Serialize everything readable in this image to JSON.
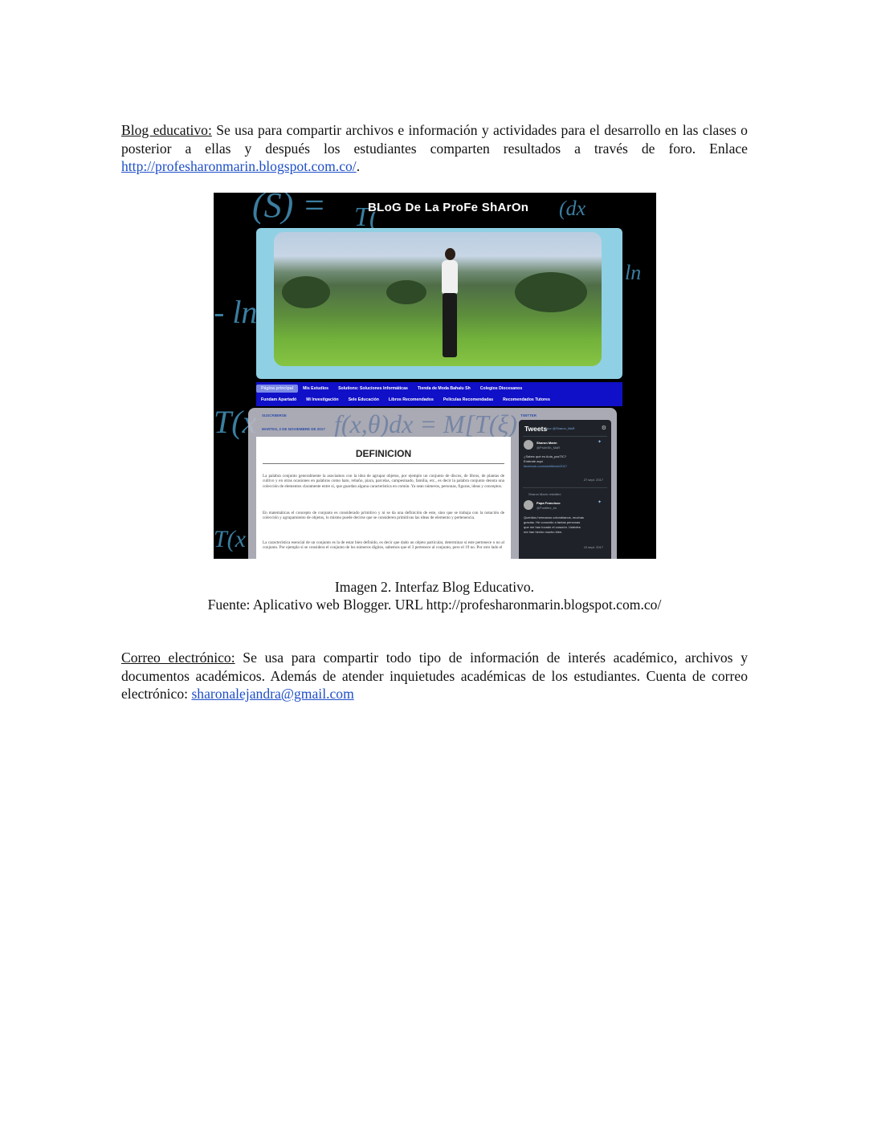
{
  "section1": {
    "lead": "Blog educativo:",
    "body": " Se usa para compartir archivos e información y actividades para el desarrollo en las clases o posterior a ellas y después los estudiantes comparten resultados a través de foro. Enlace ",
    "link": "http://profesharonmarin.blogspot.com.co/",
    "end": "."
  },
  "figure": {
    "blog_title": "BLoG De La ProFe ShArOn",
    "math_text": [
      "(S) =",
      "T(",
      "- ln",
      "ln",
      "(dx",
      "T(x",
      "T(x",
      "f(x,θ)dx = M[T(ξ)"
    ],
    "nav_row1": [
      "Página principal",
      "Mis Estudios",
      "Solutions: Soluciones Informáticas",
      "Tienda de Moda Bahalu Sh",
      "Colegios Diocesanos"
    ],
    "nav_row2": [
      "Fundam Apartadó",
      "Mi Investigación",
      "Sele Educación",
      "Libros Recomendados",
      "Películas Recomendadas",
      "Recomendados Tutores"
    ],
    "label_left": "SUSCRIBIRSE",
    "label_date": "MARTES, 2 DE NOVIEMBRE DE 2017",
    "label_right": "TWITTER",
    "post_title": "DEFINICION",
    "post_p1": "La palabra conjunto generalmente la asociamos con la idea de agrupar objetos, por ejemplo un conjunto de discos, de libros, de plantas de cultivo y en otras ocasiones en palabras como hato, rebaño, piara, parcelas, campesinado, familia, etc., es decir la palabra conjunto denota una colección de elementos claramente entre sí, que guardan alguna característica en común. Ya sean números, personas, figuras, ideas y conceptos.",
    "post_p2": "En matemáticas el concepto de conjunto es considerado primitivo y ni se da una definición de este, sino que se trabaja con la notación de colección y agrupamiento de objetos, lo mismo puede decirse que se consideren primitivas las ideas de elemento y pertenencia.",
    "post_p3": "La característica esencial de un conjunto es la de estar bien definido, es decir que dado un objeto particular, determinar si este pertenece o no al conjunto. Por ejemplo si se considera el conjunto de los números dígitos, sabemos que el 3 pertenece al conjunto, pero el 19 no. Por otro lado el",
    "twitter": {
      "header": "Tweets",
      "sub": "por @Sharon_MaR",
      "tweet1_name": "Sharon Marín",
      "tweet1_handle": "@ProfeSh_MaR",
      "tweet1_l1": "¿Sabes qué es Aula_pazTIC?",
      "tweet1_l2": "Entérate aquí",
      "tweet1_link": "facebook.com/wishMarin/2017",
      "tweet1_date": "27 sept. 2017",
      "retweet_label": "Sharon Marín retwitteó",
      "tweet2_name": "Papa Francisco",
      "tweet2_handle": "@Pontifex_es",
      "tweet2_l1": "Queridos hermanos colombianos, muchas",
      "tweet2_l2": "gracias. He conocido a tantas personas",
      "tweet2_l3": "que me han tocado el corazón. Ustedes",
      "tweet2_l4": "me han hecho mucho bien.",
      "tweet2_date": "10 sept. 2017"
    }
  },
  "caption": {
    "line1": "Imagen 2. Interfaz Blog Educativo.",
    "line2": "Fuente: Aplicativo web Blogger. URL http://profesharonmarin.blogspot.com.co/"
  },
  "section2": {
    "lead": "Correo electrónico:",
    "body": " Se usa para compartir todo tipo de información de interés académico, archivos y documentos académicos. Además de atender inquietudes académicas de los estudiantes. Cuenta de correo electrónico: ",
    "link": "sharonalejandra@gmail.com"
  },
  "colors": {
    "link": "#1f4fc8",
    "nav": "#1010c8",
    "banner": "#8fd0e4"
  }
}
